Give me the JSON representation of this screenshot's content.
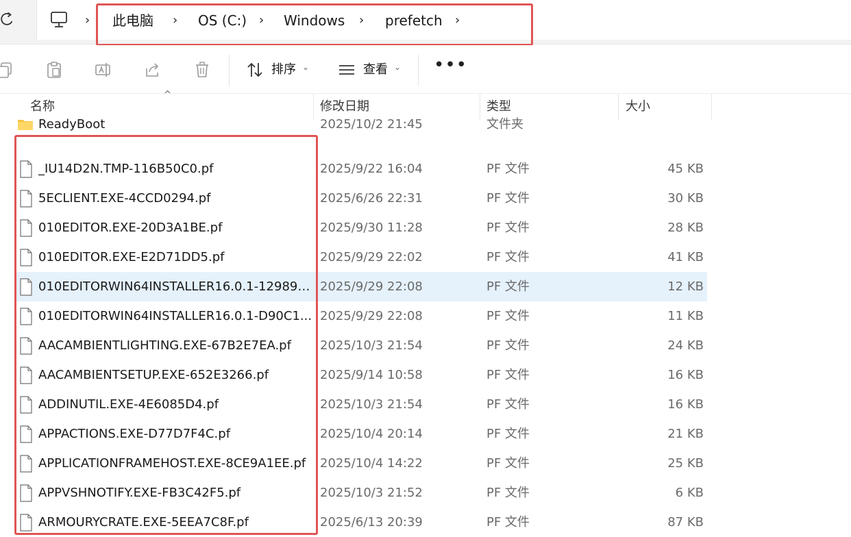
{
  "address_bar": {
    "crumbs": [
      "此电脑",
      "OS (C:)",
      "Windows",
      "prefetch"
    ]
  },
  "toolbar": {
    "sort_label": "排序",
    "view_label": "查看",
    "more_label": "•••"
  },
  "columns": {
    "name": "名称",
    "date": "修改日期",
    "type": "类型",
    "size": "大小"
  },
  "files": [
    {
      "name": "ReadyBoot",
      "date": "2025/10/2 21:45",
      "type": "文件夹",
      "size": "",
      "icon": "folder-icon"
    },
    {
      "name": "_IU14D2N.TMP-116B50C0.pf",
      "date": "2025/9/22 16:04",
      "type": "PF 文件",
      "size": "45 KB",
      "icon": "file-icon"
    },
    {
      "name": "5ECLIENT.EXE-4CCD0294.pf",
      "date": "2025/6/26 22:31",
      "type": "PF 文件",
      "size": "30 KB",
      "icon": "file-icon"
    },
    {
      "name": "010EDITOR.EXE-20D3A1BE.pf",
      "date": "2025/9/30 11:28",
      "type": "PF 文件",
      "size": "28 KB",
      "icon": "file-icon"
    },
    {
      "name": "010EDITOR.EXE-E2D71DD5.pf",
      "date": "2025/9/29 22:02",
      "type": "PF 文件",
      "size": "41 KB",
      "icon": "file-icon"
    },
    {
      "name": "010EDITORWIN64INSTALLER16.0.1-129895...",
      "date": "2025/9/29 22:08",
      "type": "PF 文件",
      "size": "12 KB",
      "icon": "file-icon"
    },
    {
      "name": "010EDITORWIN64INSTALLER16.0.1-D90C1...",
      "date": "2025/9/29 22:08",
      "type": "PF 文件",
      "size": "11 KB",
      "icon": "file-icon"
    },
    {
      "name": "AACAMBIENTLIGHTING.EXE-67B2E7EA.pf",
      "date": "2025/10/3 21:54",
      "type": "PF 文件",
      "size": "24 KB",
      "icon": "file-icon"
    },
    {
      "name": "AACAMBIENTSETUP.EXE-652E3266.pf",
      "date": "2025/9/14 10:58",
      "type": "PF 文件",
      "size": "16 KB",
      "icon": "file-icon"
    },
    {
      "name": "ADDINUTIL.EXE-4E6085D4.pf",
      "date": "2025/10/3 21:54",
      "type": "PF 文件",
      "size": "16 KB",
      "icon": "file-icon"
    },
    {
      "name": "APPACTIONS.EXE-D77D7F4C.pf",
      "date": "2025/10/4 20:14",
      "type": "PF 文件",
      "size": "21 KB",
      "icon": "file-icon"
    },
    {
      "name": "APPLICATIONFRAMEHOST.EXE-8CE9A1EE.pf",
      "date": "2025/10/4 14:22",
      "type": "PF 文件",
      "size": "25 KB",
      "icon": "file-icon"
    },
    {
      "name": "APPVSHNOTIFY.EXE-FB3C42F5.pf",
      "date": "2025/10/3 21:52",
      "type": "PF 文件",
      "size": "6 KB",
      "icon": "file-icon"
    },
    {
      "name": "ARMOURYCRATE.EXE-5EEA7C8F.pf",
      "date": "2025/6/13 20:39",
      "type": "PF 文件",
      "size": "87 KB",
      "icon": "file-icon"
    }
  ],
  "selected_index": 5,
  "colors": {
    "highlight_box": "#e05555",
    "selection": "#e5f1fb"
  }
}
